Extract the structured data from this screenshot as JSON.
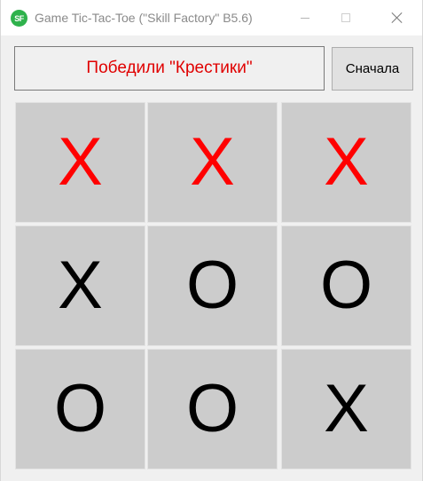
{
  "window": {
    "title": "Game Tic-Tac-Toe (\"Skill Factory\" B5.6)",
    "icon_text": "SF",
    "icon_color": "#2fb24c"
  },
  "status": {
    "text": "Победили \"Крестики\"",
    "color": "#e00000"
  },
  "restart_button": {
    "label": "Сначала"
  },
  "board": {
    "win_color": "#ff0000",
    "cells": [
      {
        "mark": "X",
        "winning": true
      },
      {
        "mark": "X",
        "winning": true
      },
      {
        "mark": "X",
        "winning": true
      },
      {
        "mark": "X",
        "winning": false
      },
      {
        "mark": "O",
        "winning": false
      },
      {
        "mark": "O",
        "winning": false
      },
      {
        "mark": "O",
        "winning": false
      },
      {
        "mark": "O",
        "winning": false
      },
      {
        "mark": "X",
        "winning": false
      }
    ]
  }
}
